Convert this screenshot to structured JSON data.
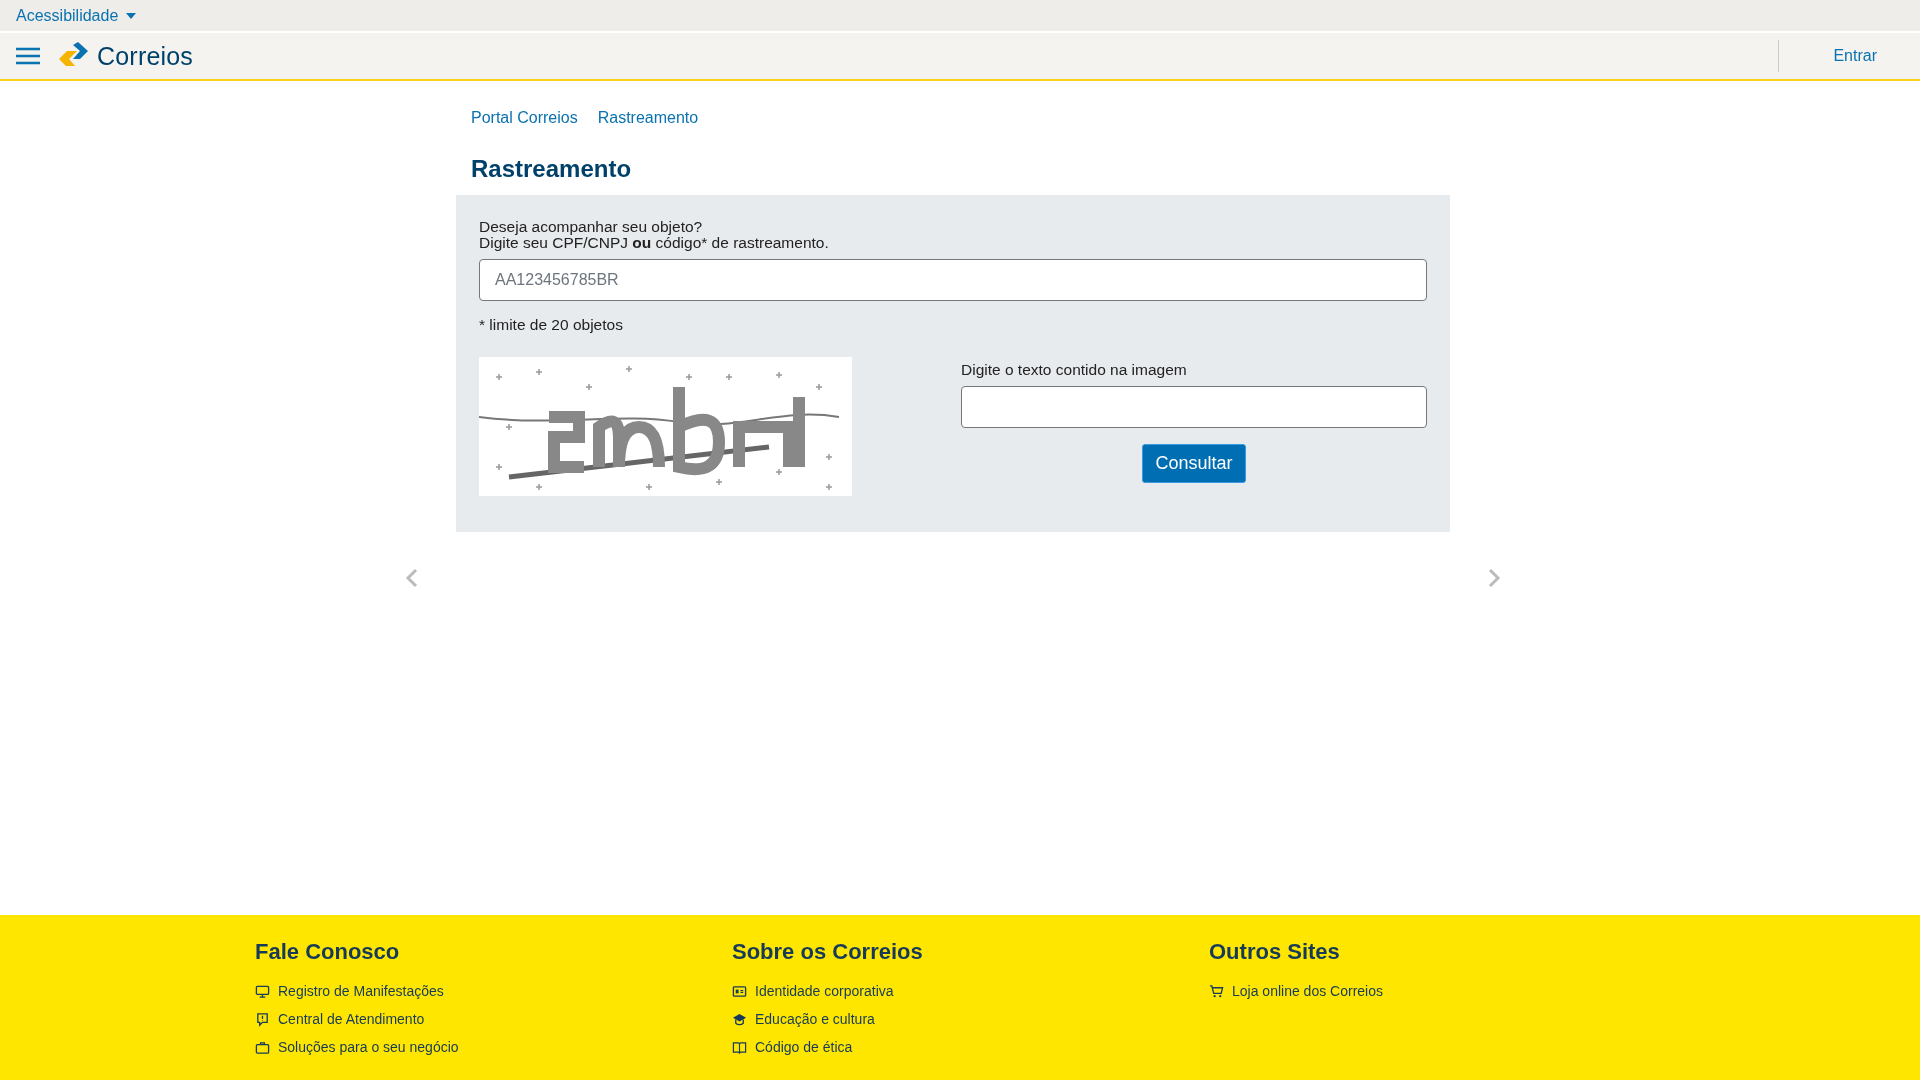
{
  "top_bar": {
    "accessibility_menu": "Acessibilidade"
  },
  "nav_bar": {
    "logo_text": "Correios",
    "login": "Entrar"
  },
  "breadcrumb": [
    "Portal Correios",
    "Rastreamento"
  ],
  "page_title": "Rastreamento",
  "tracking_form": {
    "prompt_line_1": "Deseja acompanhar seu objeto?",
    "prompt_line_2": "Digite seu CPF/CNPJ **ou** código* de rastreamento.",
    "tracking_field": {
      "placeholder": "AA123456785BR"
    },
    "limit_note": "* limite de 20 objetos",
    "captcha_label": "Digite o texto contido na imagem",
    "submit": "Consultar"
  },
  "footer": {
    "columns": [
      {
        "title": "Fale Conosco",
        "links": [
          {
            "kind": "monitor",
            "label": "Registro de Manifestações"
          },
          {
            "kind": "chat",
            "label": "Central de Atendimento"
          },
          {
            "kind": "briefcase",
            "label": "Soluções para o seu negócio"
          }
        ]
      },
      {
        "title": "Sobre os Correios",
        "links": [
          {
            "kind": "idcard",
            "label": "Identidade corporativa"
          },
          {
            "kind": "cap",
            "label": "Educação e cultura"
          },
          {
            "kind": "book",
            "label": "Código de ética"
          }
        ]
      },
      {
        "title": "Outros Sites",
        "links": [
          {
            "kind": "cart",
            "label": "Loja online dos Correios"
          }
        ]
      }
    ]
  }
}
